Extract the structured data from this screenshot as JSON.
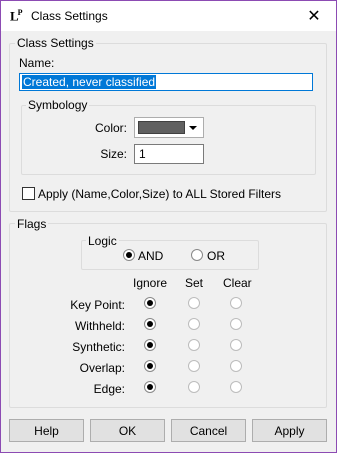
{
  "window": {
    "app_icon_text": "LP",
    "title": "Class Settings",
    "close_glyph": "✕"
  },
  "class_settings": {
    "group_label": "Class Settings",
    "name_label": "Name:",
    "name_value": "Created, never classified",
    "symbology": {
      "group_label": "Symbology",
      "color_label": "Color:",
      "color_value": "#606060",
      "size_label": "Size:",
      "size_value": "1"
    },
    "apply_all_label": "Apply (Name,Color,Size) to ALL Stored Filters",
    "apply_all_checked": false
  },
  "flags": {
    "group_label": "Flags",
    "logic": {
      "group_label": "Logic",
      "options": [
        "AND",
        "OR"
      ],
      "selected": "AND"
    },
    "columns": [
      "Ignore",
      "Set",
      "Clear"
    ],
    "rows": [
      {
        "label": "Key Point:",
        "selected": "Ignore"
      },
      {
        "label": "Withheld:",
        "selected": "Ignore"
      },
      {
        "label": "Synthetic:",
        "selected": "Ignore"
      },
      {
        "label": "Overlap:",
        "selected": "Ignore"
      },
      {
        "label": "Edge:",
        "selected": "Ignore"
      }
    ]
  },
  "buttons": {
    "help": "Help",
    "ok": "OK",
    "cancel": "Cancel",
    "apply": "Apply"
  }
}
